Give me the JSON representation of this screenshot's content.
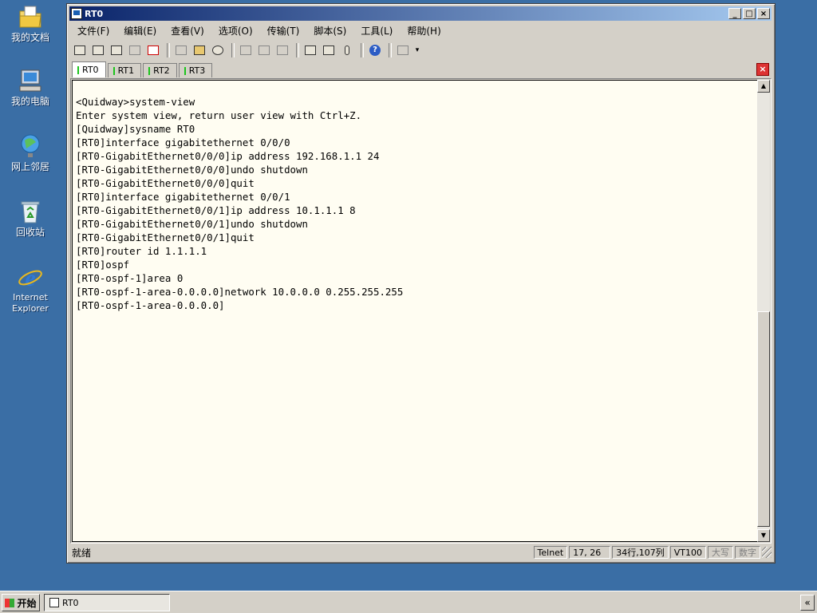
{
  "desktop": {
    "icons": [
      {
        "label": "我的文档",
        "icon": "my-documents-icon"
      },
      {
        "label": "我的电脑",
        "icon": "my-computer-icon"
      },
      {
        "label": "网上邻居",
        "icon": "network-places-icon"
      },
      {
        "label": "回收站",
        "icon": "recycle-bin-icon"
      },
      {
        "label": "Internet Explorer",
        "icon": "internet-explorer-icon"
      }
    ]
  },
  "window": {
    "title": "RT0",
    "controls": {
      "minimize": "_",
      "maximize": "□",
      "close": "×"
    },
    "menu": [
      "文件(F)",
      "编辑(E)",
      "查看(V)",
      "选项(O)",
      "传输(T)",
      "脚本(S)",
      "工具(L)",
      "帮助(H)"
    ],
    "tabs": [
      "RT0",
      "RT1",
      "RT2",
      "RT3"
    ],
    "active_tab": "RT0",
    "terminal_lines": [
      "<Quidway>system-view",
      "Enter system view, return user view with Ctrl+Z.",
      "[Quidway]sysname RT0",
      "[RT0]interface gigabitethernet 0/0/0",
      "[RT0-GigabitEthernet0/0/0]ip address 192.168.1.1 24",
      "[RT0-GigabitEthernet0/0/0]undo shutdown",
      "[RT0-GigabitEthernet0/0/0]quit",
      "[RT0]interface gigabitethernet 0/0/1",
      "[RT0-GigabitEthernet0/0/1]ip address 10.1.1.1 8",
      "[RT0-GigabitEthernet0/0/1]undo shutdown",
      "[RT0-GigabitEthernet0/0/1]quit",
      "[RT0]router id 1.1.1.1",
      "[RT0]ospf",
      "[RT0-ospf-1]area 0",
      "[RT0-ospf-1-area-0.0.0.0]network 10.0.0.0 0.255.255.255",
      "[RT0-ospf-1-area-0.0.0.0]"
    ],
    "status": {
      "ready": "就绪",
      "protocol": "Telnet",
      "cursor": "17,  26",
      "size": "34行,107列",
      "emulation": "VT100",
      "caps": "大写",
      "num": "数字"
    }
  },
  "taskbar": {
    "start_label": "开始",
    "task_label": "RT0",
    "tray_arrow": "«"
  },
  "colors": {
    "desktop": "#3a6ea5",
    "terminal_bg": "#fffdf2",
    "tab_indicator": "#1cc41c",
    "title_gradient_start": "#0a246a"
  }
}
